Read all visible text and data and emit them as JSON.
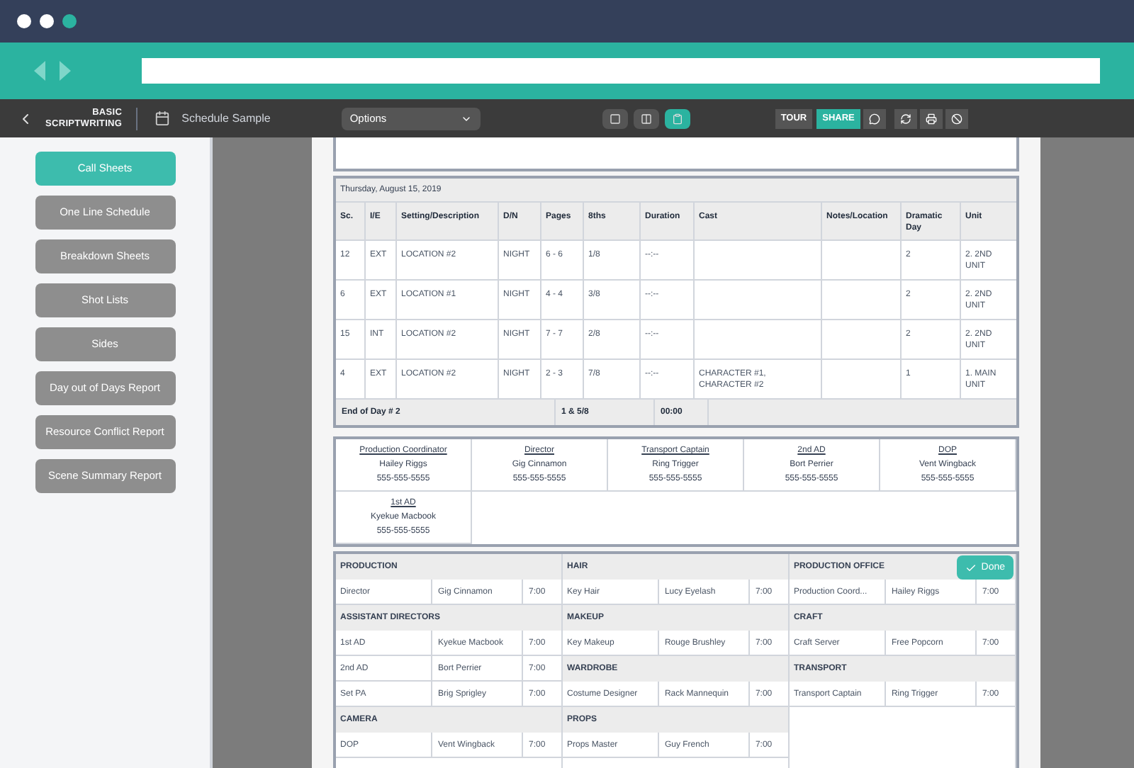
{
  "app_bar": {
    "logo_top": "BASIC",
    "logo_bottom": "SCRIPTWRITING",
    "document_title": "Schedule Sample",
    "options_dropdown": "Options",
    "view_buttons": [
      {
        "selected": false
      },
      {
        "selected": false
      },
      {
        "selected": true
      }
    ],
    "tour": "TOUR",
    "share": "SHARE"
  },
  "sidebar": {
    "items": [
      {
        "label": "Call Sheets",
        "selected": true
      },
      {
        "label": "One Line Schedule",
        "selected": false
      },
      {
        "label": "Breakdown Sheets",
        "selected": false
      },
      {
        "label": "Shot Lists",
        "selected": false
      },
      {
        "label": "Sides",
        "selected": false
      },
      {
        "label": "Day out of Days Report",
        "selected": false
      },
      {
        "label": "Resource Conflict Report",
        "selected": false
      },
      {
        "label": "Scene Summary Report",
        "selected": false
      }
    ]
  },
  "schedule": {
    "date": "Thursday, August 15, 2019",
    "columns": [
      "Sc.",
      "I/E",
      "Setting/Description",
      "D/N",
      "Pages",
      "8ths",
      "Duration",
      "Cast",
      "Notes/Location",
      "Dramatic Day",
      "Unit"
    ],
    "rows": [
      [
        "12",
        "EXT",
        "LOCATION #2",
        "NIGHT",
        "6 - 6",
        "1/8",
        "--:--",
        "",
        "",
        "2",
        "2. 2ND UNIT"
      ],
      [
        "6",
        "EXT",
        "LOCATION #1",
        "NIGHT",
        "4 - 4",
        "3/8",
        "--:--",
        "",
        "",
        "2",
        "2. 2ND UNIT"
      ],
      [
        "15",
        "INT",
        "LOCATION #2",
        "NIGHT",
        "7 - 7",
        "2/8",
        "--:--",
        "",
        "",
        "2",
        "2. 2ND UNIT"
      ],
      [
        "4",
        "EXT",
        "LOCATION #2",
        "NIGHT",
        "2 - 3",
        "7/8",
        "--:--",
        "CHARACTER #1, CHARACTER #2",
        "",
        "1",
        "1. MAIN UNIT"
      ]
    ],
    "footer": {
      "label": "End of Day # 2",
      "eighths": "1 & 5/8",
      "duration": "00:00"
    }
  },
  "contacts": [
    {
      "role": "Production Coordinator",
      "name": "Hailey Riggs",
      "phone": "555-555-5555"
    },
    {
      "role": "Director",
      "name": "Gig Cinnamon",
      "phone": "555-555-5555"
    },
    {
      "role": "Transport Captain",
      "name": "Ring Trigger",
      "phone": "555-555-5555"
    },
    {
      "role": "2nd AD",
      "name": "Bort Perrier",
      "phone": "555-555-5555"
    },
    {
      "role": "DOP",
      "name": "Vent Wingback",
      "phone": "555-555-5555"
    },
    {
      "role": "1st AD",
      "name": "Kyekue Macbook",
      "phone": "555-555-5555"
    }
  ],
  "departments": [
    [
      {
        "title": "PRODUCTION",
        "rows": [
          [
            "Director",
            "Gig Cinnamon",
            "7:00"
          ]
        ]
      },
      {
        "title": "ASSISTANT DIRECTORS",
        "rows": [
          [
            "1st AD",
            "Kyekue Macbook",
            "7:00"
          ],
          [
            "2nd AD",
            "Bort Perrier",
            "7:00"
          ],
          [
            "Set PA",
            "Brig Sprigley",
            "7:00"
          ]
        ]
      },
      {
        "title": "CAMERA",
        "rows": [
          [
            "DOP",
            "Vent Wingback",
            "7:00"
          ]
        ]
      }
    ],
    [
      {
        "title": "HAIR",
        "rows": [
          [
            "Key Hair",
            "Lucy Eyelash",
            "7:00"
          ]
        ]
      },
      {
        "title": "MAKEUP",
        "rows": [
          [
            "Key Makeup",
            "Rouge Brushley",
            "7:00"
          ]
        ]
      },
      {
        "title": "WARDROBE",
        "rows": [
          [
            "Costume Designer",
            "Rack Mannequin",
            "7:00"
          ]
        ]
      },
      {
        "title": "PROPS",
        "rows": [
          [
            "Props Master",
            "Guy French",
            "7:00"
          ]
        ]
      }
    ],
    [
      {
        "title": "PRODUCTION OFFICE",
        "rows": [
          [
            "Production Coord...",
            "Hailey Riggs",
            "7:00"
          ]
        ]
      },
      {
        "title": "CRAFT",
        "rows": [
          [
            "Craft Server",
            "Free Popcorn",
            "7:00"
          ]
        ]
      },
      {
        "title": "TRANSPORT",
        "rows": [
          [
            "Transport Captain",
            "Ring Trigger",
            "7:00"
          ]
        ]
      }
    ]
  ],
  "done_button": "Done"
}
